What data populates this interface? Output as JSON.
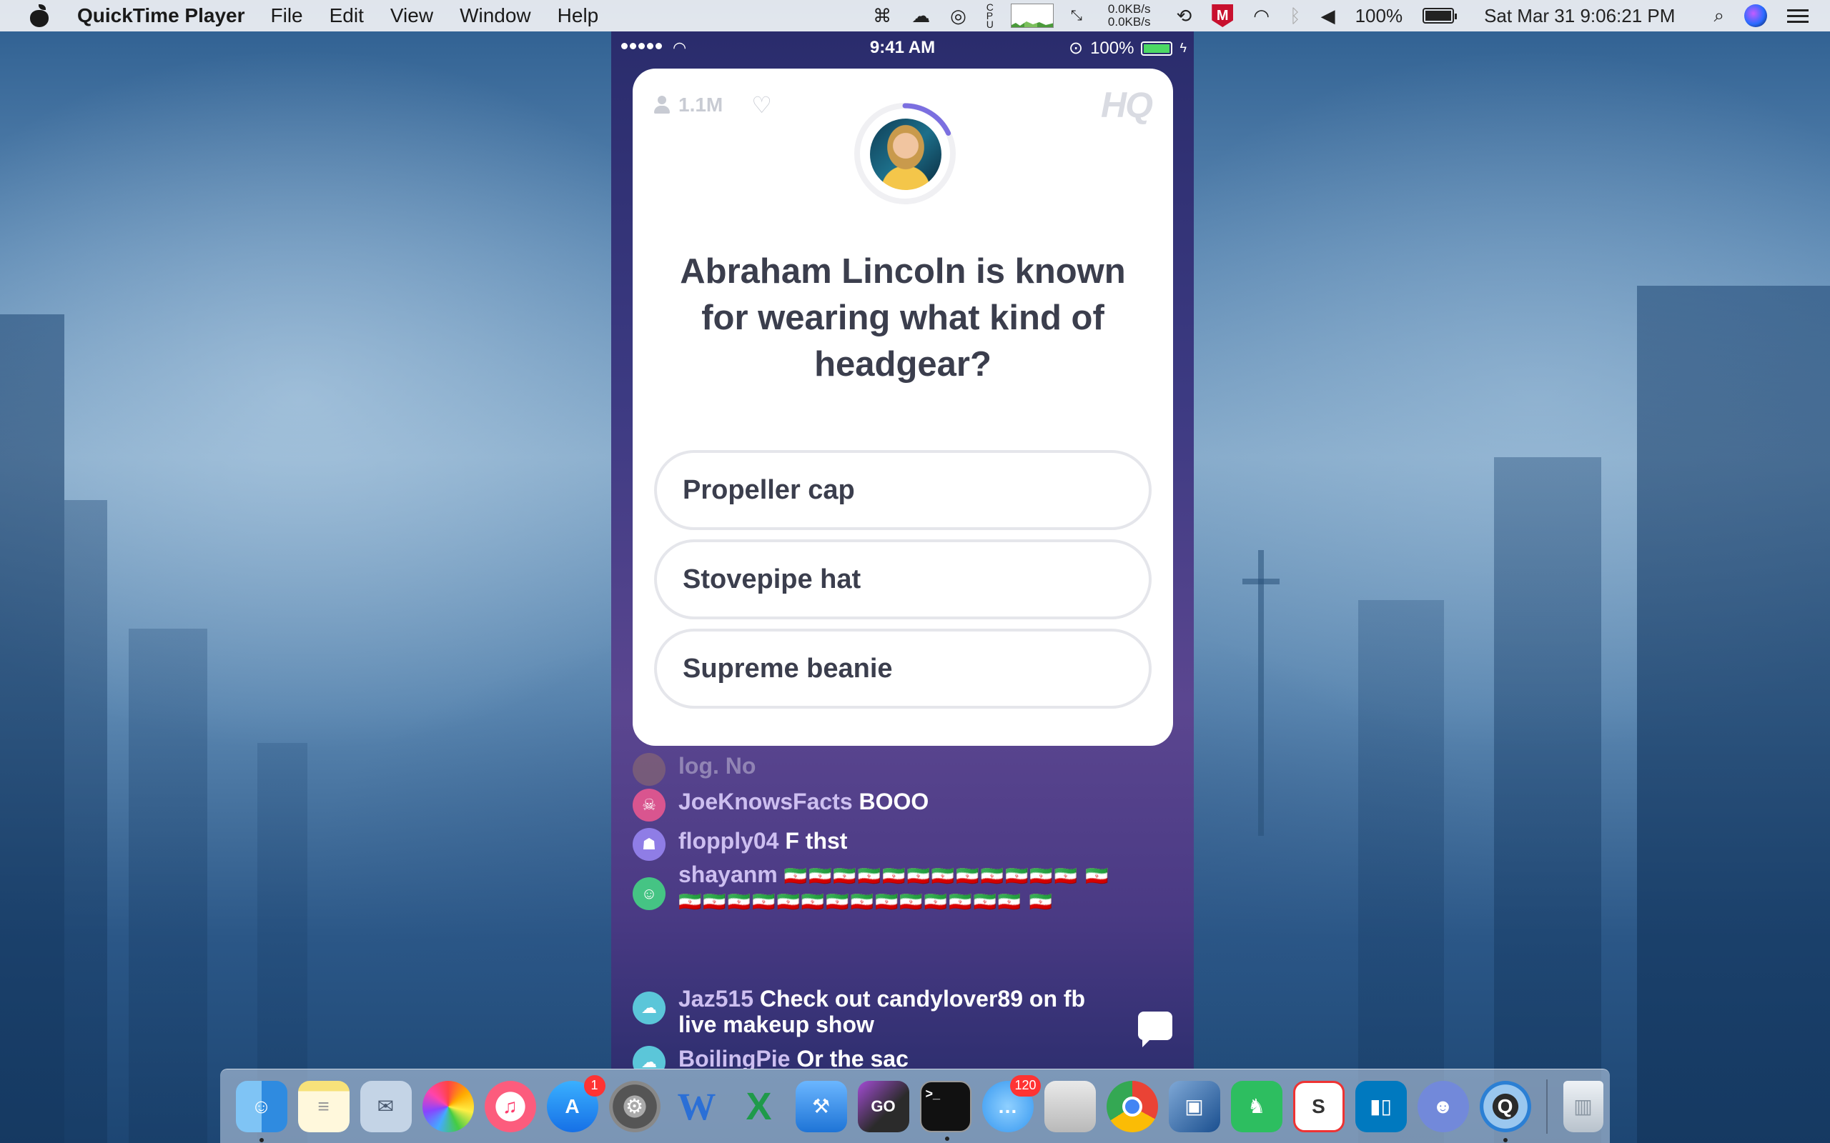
{
  "menubar": {
    "app_name": "QuickTime Player",
    "menus": [
      "File",
      "Edit",
      "View",
      "Window",
      "Help"
    ],
    "net_up": "0.0KB/s",
    "net_down": "0.0KB/s",
    "battery": "100%",
    "datetime": "Sat Mar 31  9:06:21 PM"
  },
  "phone": {
    "status_time": "9:41 AM",
    "status_battery": "100%",
    "viewer_count": "1.1M",
    "logo": "HQ",
    "timer_progress": 0.18,
    "question": "Abraham Lincoln is known for wearing what kind of headgear?",
    "answers": [
      "Propeller cap",
      "Stovepipe hat",
      "Supreme beanie"
    ],
    "chat": [
      {
        "user": "",
        "text": "log. No",
        "avatar_color": "#b58a5a"
      },
      {
        "user": "JoeKnowsFacts",
        "text": "BOOO",
        "avatar_color": "#d9558f"
      },
      {
        "user": "flopply04",
        "text": "F thst",
        "avatar_color": "#8f7de6"
      },
      {
        "user": "shayanm",
        "text": "🇮🇷🇮🇷🇮🇷🇮🇷🇮🇷🇮🇷🇮🇷🇮🇷🇮🇷🇮🇷🇮🇷🇮🇷 🇮🇷🇮🇷🇮🇷🇮🇷🇮🇷🇮🇷🇮🇷🇮🇷🇮🇷🇮🇷🇮🇷🇮🇷🇮🇷🇮🇷🇮🇷 🇮🇷",
        "avatar_color": "#45c484"
      },
      {
        "user": "Jaz515",
        "text": "Check out candylover89 on fb live makeup show",
        "avatar_color": "#5bc6d9"
      },
      {
        "user": "BoilingPie",
        "text": "Or the sac",
        "avatar_color": "#5bc6d9"
      }
    ]
  },
  "dock": {
    "app_store_badge": "1",
    "messages_badge": "120"
  }
}
